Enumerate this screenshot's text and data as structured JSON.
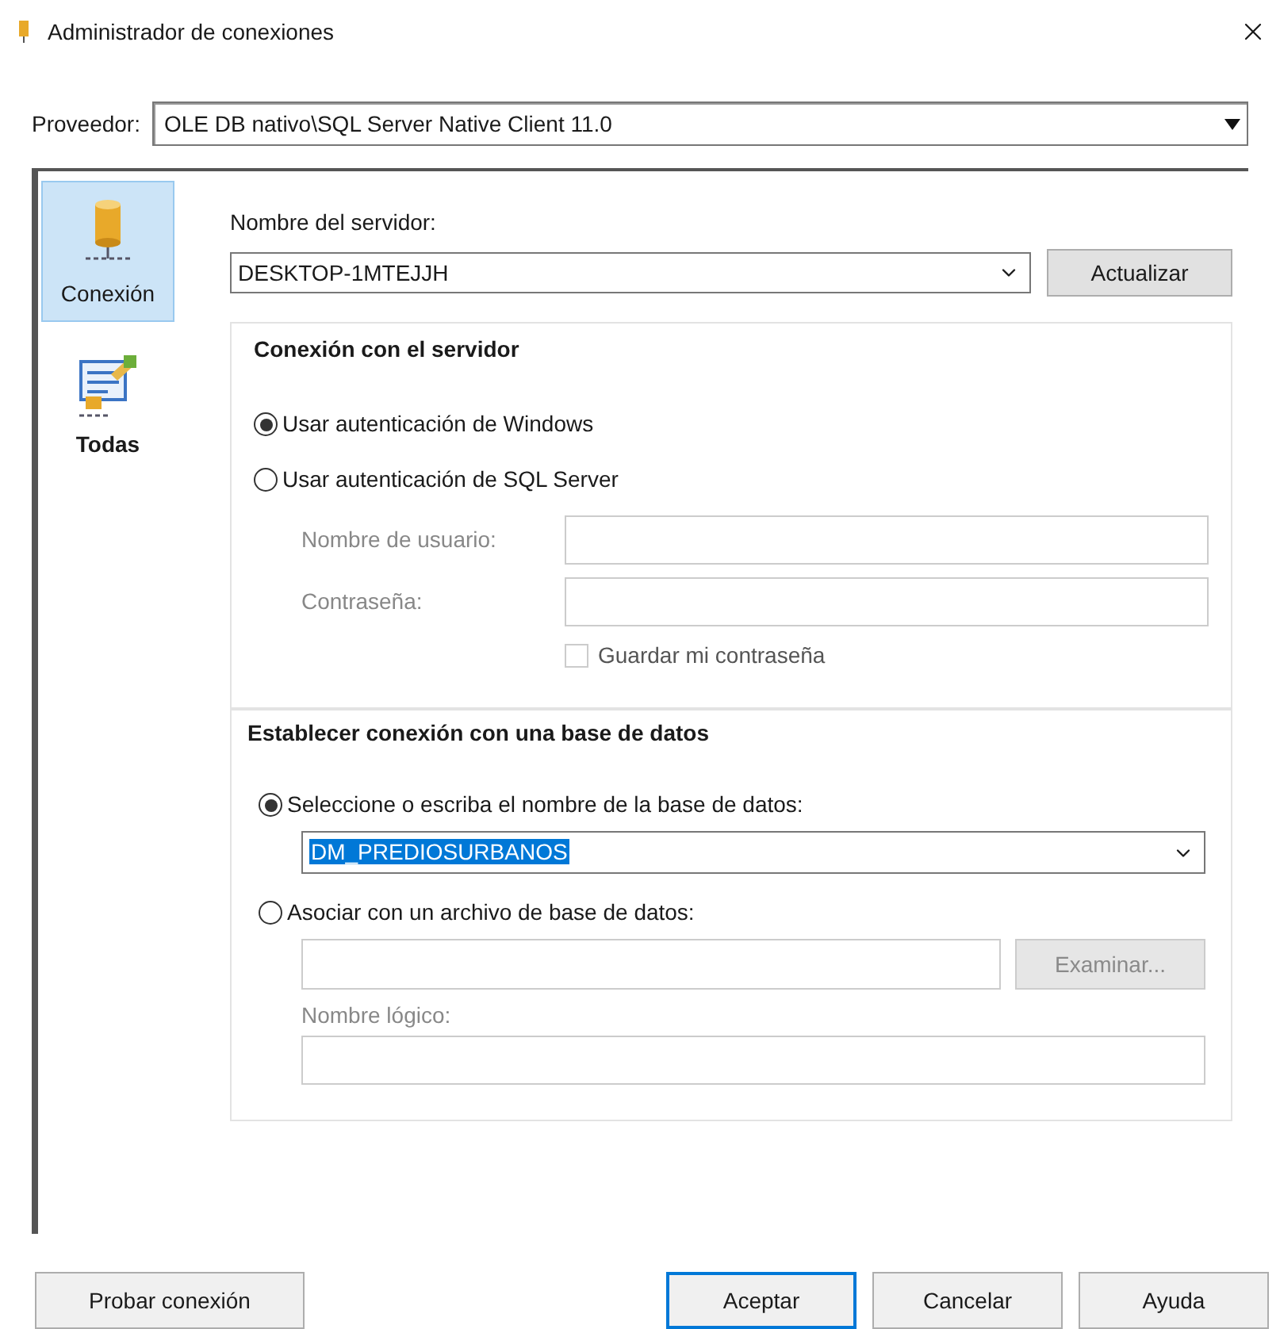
{
  "window": {
    "title": "Administrador de conexiones"
  },
  "provider": {
    "label": "Proveedor:",
    "value": "OLE DB nativo\\SQL Server Native Client 11.0"
  },
  "sidebar": {
    "items": [
      {
        "label": "Conexión",
        "selected": true,
        "kind": "database"
      },
      {
        "label": "Todas",
        "selected": false,
        "kind": "properties"
      }
    ]
  },
  "server": {
    "label": "Nombre del servidor:",
    "value": "DESKTOP-1MTEJJH",
    "refresh_button": "Actualizar"
  },
  "server_connection": {
    "title": "Conexión con el servidor",
    "auth_options": [
      {
        "label": "Usar autenticación de Windows",
        "selected": true
      },
      {
        "label": "Usar autenticación de SQL Server",
        "selected": false
      }
    ],
    "username_label": "Nombre de usuario:",
    "password_label": "Contraseña:",
    "save_password": {
      "label": "Guardar mi contraseña",
      "checked": false,
      "disabled": true
    }
  },
  "database": {
    "title": "Establecer conexión con una base de datos",
    "options": [
      {
        "label": "Seleccione o escriba el nombre de la base de datos:",
        "selected": true
      },
      {
        "label": "Asociar con un archivo de base de datos:",
        "selected": false
      }
    ],
    "database_value": "DM_PREDIOSURBANOS",
    "browse_button": {
      "label": "Examinar...",
      "disabled": true
    },
    "logical_name_label": "Nombre lógico:"
  },
  "buttons": [
    {
      "label": "Probar conexión",
      "default": false
    },
    {
      "label": "Aceptar",
      "default": true
    },
    {
      "label": "Cancelar",
      "default": false
    },
    {
      "label": "Ayuda",
      "default": false
    }
  ]
}
